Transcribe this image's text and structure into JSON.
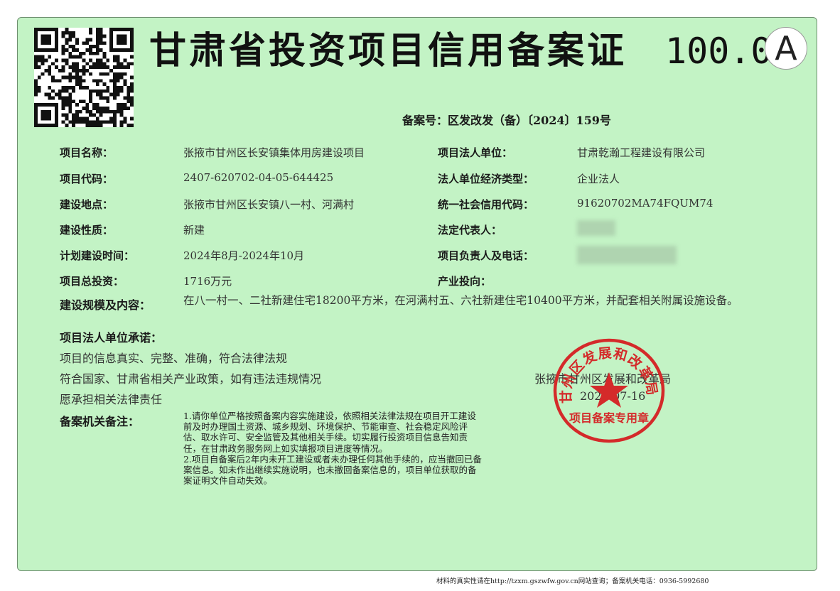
{
  "header": {
    "title": "甘肃省投资项目信用备案证",
    "score": "100.0",
    "grade": "A",
    "record_no": "备案号：区发改发（备）〔2024〕159号"
  },
  "fields": {
    "project_name": {
      "label": "项目名称：",
      "value": "张掖市甘州区长安镇集体用房建设项目"
    },
    "project_code": {
      "label": "项目代码：",
      "value": "2407-620702-04-05-644425"
    },
    "site": {
      "label": "建设地点：",
      "value": "张掖市甘州区长安镇八一村、河满村"
    },
    "nature": {
      "label": "建设性质：",
      "value": "新建"
    },
    "schedule": {
      "label": "计划建设时间：",
      "value": "2024年8月-2024年10月"
    },
    "investment": {
      "label": "项目总投资：",
      "value": "1716万元"
    },
    "legal_unit": {
      "label": "项目法人单位：",
      "value": "甘肃乾瀚工程建设有限公司"
    },
    "econ_type": {
      "label": "法人单位经济类型：",
      "value": "企业法人"
    },
    "credit_code": {
      "label": "统一社会信用代码：",
      "value": "91620702MA74FQUM74"
    },
    "legal_rep": {
      "label": "法定代表人：",
      "value": ""
    },
    "contact": {
      "label": "项目负责人及电话：",
      "value": ""
    },
    "industry": {
      "label": "产业投向：",
      "value": ""
    },
    "scope": {
      "label": "建设规模及内容：",
      "value": "在八一村一、二社新建住宅18200平方米，在河满村五、六社新建住宅10400平方米，并配套相关附属设施设备。"
    }
  },
  "commitment": {
    "label": "项目法人单位承诺：",
    "line1": "项目的信息真实、完整、准确，符合法律法规",
    "line2": "符合国家、甘肃省相关产业政策，如有违法违规情况",
    "line3": "愿承担相关法律责任"
  },
  "issuer": {
    "name": "张掖市甘州区发展和改革局",
    "date": "2024-07-16"
  },
  "seal": {
    "top_text": "甘州区发展和改革局",
    "bottom_text": "项目备案专用章",
    "color": "#d42a2a"
  },
  "remarks": {
    "label": "备案机关备注：",
    "note1": "1.请你单位严格按照备案内容实施建设，依照相关法律法规在项目开工建设前及时办理国土资源、城乡规划、环境保护、节能审查、社会稳定风险评估、取水许可、安全监管及其他相关手续。切实履行投资项目信息告知责任，在甘肃政务服务网上如实填报项目进度等情况。",
    "note2": "2.项目自备案后2年内未开工建设或者未办理任何其他手续的，应当撤回已备案信息。如未作出继续实施说明，也未撤回备案信息的，项目单位获取的备案证明文件自动失效。"
  },
  "footer": "材料的真实性请在http://tzxm.gszwfw.gov.cn网站查询；备案机关电话：0936-5992680",
  "colors": {
    "background": "#c3f3c5",
    "seal": "#d42a2a"
  },
  "icons": {
    "qr": "qr-code-icon",
    "grade": "grade-a-badge"
  }
}
